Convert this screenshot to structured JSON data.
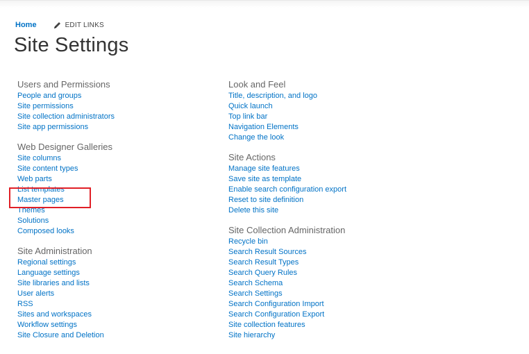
{
  "breadcrumb": {
    "home": "Home",
    "edit_links": "EDIT LINKS",
    "edit_icon": "pencil-icon"
  },
  "page_title": "Site Settings",
  "left_column": [
    {
      "heading": "Users and Permissions",
      "links": [
        "People and groups",
        "Site permissions",
        "Site collection administrators",
        "Site app permissions"
      ]
    },
    {
      "heading": "Web Designer Galleries",
      "links": [
        "Site columns",
        "Site content types",
        "Web parts",
        "List templates",
        "Master pages",
        "Themes",
        "Solutions",
        "Composed looks"
      ]
    },
    {
      "heading": "Site Administration",
      "links": [
        "Regional settings",
        "Language settings",
        "Site libraries and lists",
        "User alerts",
        "RSS",
        "Sites and workspaces",
        "Workflow settings",
        "Site Closure and Deletion"
      ]
    }
  ],
  "right_column": [
    {
      "heading": "Look and Feel",
      "links": [
        "Title, description, and logo",
        "Quick launch",
        "Top link bar",
        "Navigation Elements",
        "Change the look"
      ]
    },
    {
      "heading": "Site Actions",
      "links": [
        "Manage site features",
        "Save site as template",
        "Enable search configuration export",
        "Reset to site definition",
        "Delete this site"
      ]
    },
    {
      "heading": "Site Collection Administration",
      "links": [
        "Recycle bin",
        "Search Result Sources",
        "Search Result Types",
        "Search Query Rules",
        "Search Schema",
        "Search Settings",
        "Search Configuration Import",
        "Search Configuration Export",
        "Site collection features",
        "Site hierarchy"
      ]
    }
  ],
  "colors": {
    "link": "#0072c6",
    "heading": "#666666",
    "highlight": "#e01f26"
  }
}
